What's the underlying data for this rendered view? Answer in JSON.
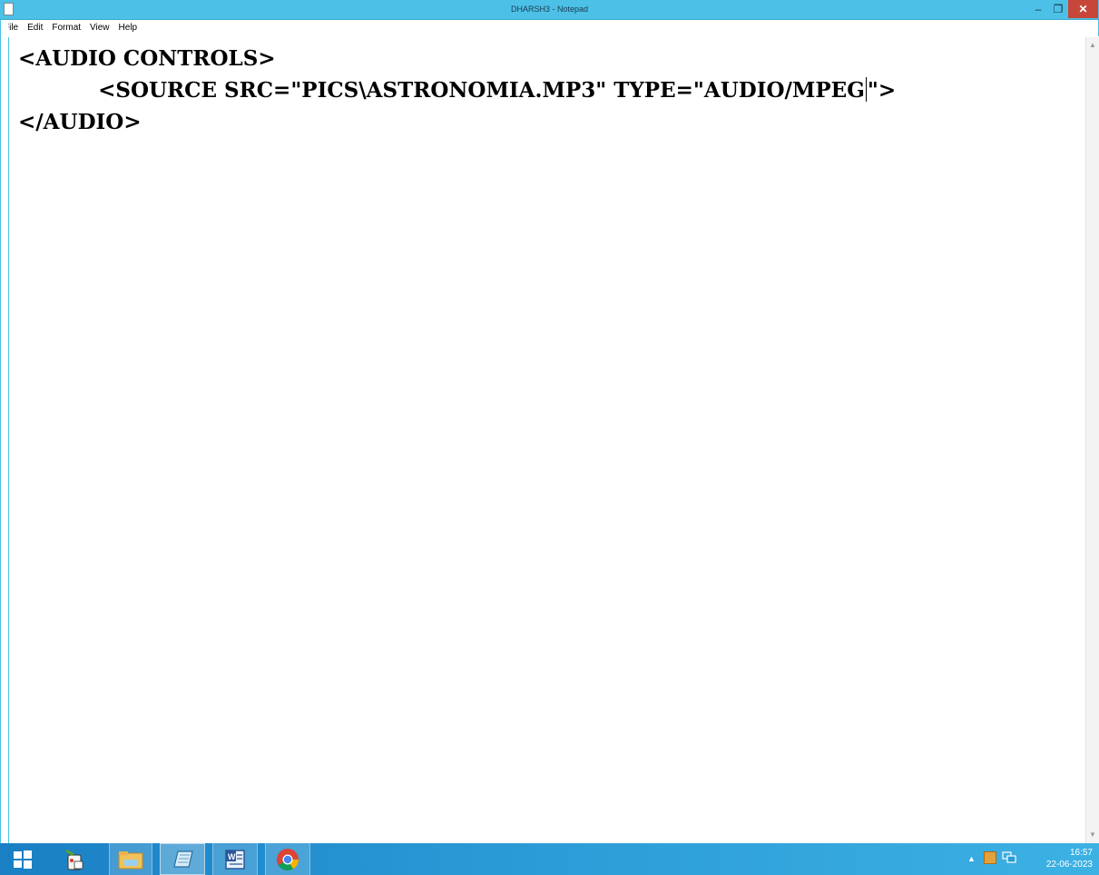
{
  "window": {
    "title": "DHARSH3 - Notepad",
    "min_glyph": "–",
    "max_glyph": "❐",
    "close_glyph": "✕"
  },
  "menu": [
    "File",
    "Edit",
    "Format",
    "View",
    "Help"
  ],
  "editor": {
    "lines": [
      "<AUDIO CONTROLS>",
      "           <SOURCE SRC=\"PICS\\ASTRONOMIA.MP3\" TYPE=\"AUDIO/MPEG",
      "\">",
      "</AUDIO>"
    ]
  },
  "scrollbar": {
    "up": "▲",
    "down": "▼"
  },
  "taskbar": {
    "apps": [
      "start-icon",
      "paint-icon",
      "file-explorer-icon",
      "notepad-icon",
      "word-icon",
      "chrome-icon"
    ],
    "tray_chevron": "▲"
  },
  "clock": {
    "time": "16:57",
    "date": "22-06-2023"
  },
  "colors": {
    "titlebar": "#4cc0e6",
    "close": "#c7463a",
    "taskbar": "#2a9ad6"
  }
}
